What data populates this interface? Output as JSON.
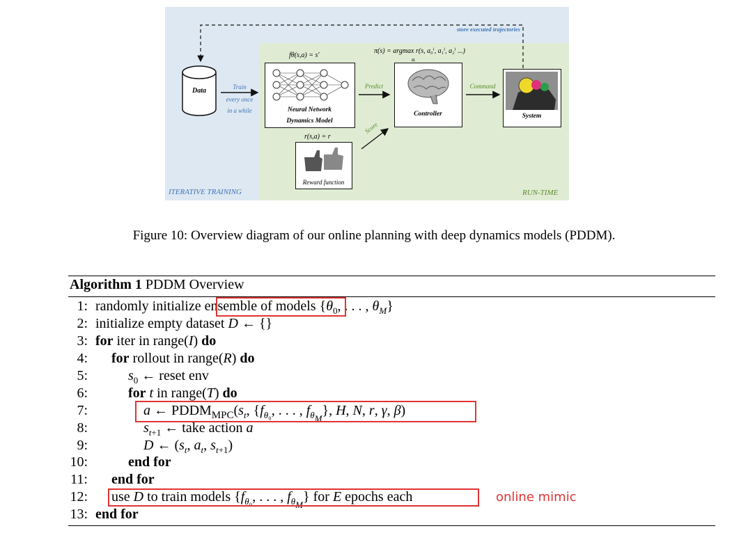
{
  "figure": {
    "data_label": "Data",
    "train_label": "Train",
    "every_once_label": "every once",
    "in_a_while_label": "in a while",
    "nn_formula": "fθ(s,a) = s′",
    "nn_caption_1": "Neural Network",
    "nn_caption_2": "Dynamics Model",
    "predict_label": "Predict",
    "policy_formula": "π(s) = argmax r(s, a₀ⁱ, a₁ⁱ, a₂ⁱ ...)",
    "policy_sub": "aᵢ",
    "controller_label": "Controller",
    "command_label": "Command",
    "system_label": "System",
    "store_label": "store executed trajectories",
    "reward_formula": "r(s,a) = r",
    "reward_label": "Reward function",
    "score_label": "Score",
    "iterative_training_label": "ITERATIVE TRAINING",
    "run_time_label": "RUN-TIME",
    "colors": {
      "training_bg": "#dde8f2",
      "runtime_bg": "#dfecd3",
      "highlight": "#e03333"
    }
  },
  "caption": "Figure 10: Overview diagram of our online planning with deep dynamics models (PDDM).",
  "algorithm": {
    "title_bold": "Algorithm 1",
    "title_rest": "PDDM Overview",
    "line_numbers": [
      "1:",
      "2:",
      "3:",
      "4:",
      "5:",
      "6:",
      "7:",
      "8:",
      "9:",
      "10:",
      "11:",
      "12:",
      "13:"
    ],
    "line1_text": "randomly initialize",
    "line1_highlight": "ensemble of models",
    "line1_math": "{θ₀, . . . , θ_M}",
    "line2_text": "initialize empty dataset",
    "line3_kw": "for",
    "line3_text": "iter in range(I)",
    "line3_do": "do",
    "line4_kw": "for",
    "line4_text": "rollout in range(R)",
    "line4_do": "do",
    "line5_text": "reset env",
    "line6_kw": "for",
    "line6_text": "t in range(T)",
    "line6_do": "do",
    "line8_text": "take action",
    "line10_text": "end for",
    "line11_text": "end for",
    "line12_use": "use",
    "line12_mid": "to train models",
    "line12_for": "for",
    "line12_end": "epochs each",
    "line13_text": "end for"
  },
  "annotation": "online mimic"
}
